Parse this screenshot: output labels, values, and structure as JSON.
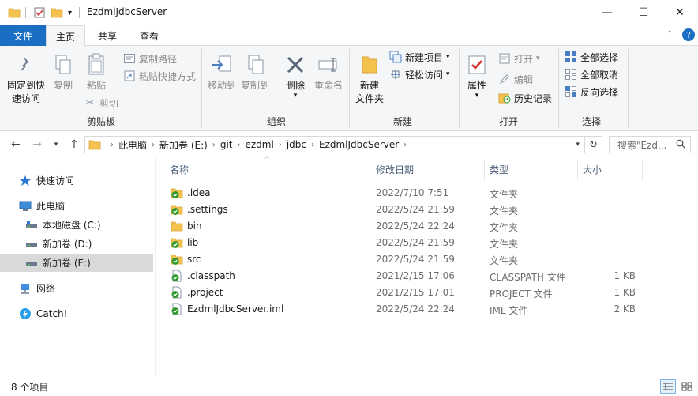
{
  "window": {
    "title": "EzdmlJdbcServer",
    "minimize": "—",
    "maximize": "☐",
    "close": "✕"
  },
  "ribbon_tabs": {
    "file": "文件",
    "home": "主页",
    "share": "共享",
    "view": "查看"
  },
  "ribbon": {
    "clipboard": {
      "group": "剪贴板",
      "pin_line1": "固定到快",
      "pin_line2": "速访问",
      "copy": "复制",
      "paste": "粘贴",
      "copy_path": "复制路径",
      "paste_shortcut": "粘贴快捷方式",
      "cut": "剪切"
    },
    "organize": {
      "group": "组织",
      "move_to": "移动到",
      "copy_to": "复制到",
      "delete": "删除",
      "rename": "重命名"
    },
    "new": {
      "group": "新建",
      "new_folder_line1": "新建",
      "new_folder_line2": "文件夹",
      "new_item": "新建项目",
      "easy_access": "轻松访问"
    },
    "open": {
      "group": "打开",
      "properties": "属性",
      "open": "打开",
      "edit": "编辑",
      "history": "历史记录"
    },
    "select": {
      "group": "选择",
      "select_all": "全部选择",
      "select_none": "全部取消",
      "invert": "反向选择"
    }
  },
  "address": {
    "crumbs": [
      "此电脑",
      "新加卷 (E:)",
      "git",
      "ezdml",
      "jdbc",
      "EzdmlJdbcServer"
    ],
    "search_placeholder": "搜索\"Ezd..."
  },
  "sidebar": {
    "items": [
      {
        "label": "快速访问",
        "icon": "star-icon"
      },
      {
        "label": "此电脑",
        "icon": "computer-icon"
      },
      {
        "label": "本地磁盘 (C:)",
        "icon": "drive-icon"
      },
      {
        "label": "新加卷 (D:)",
        "icon": "drive-icon"
      },
      {
        "label": "新加卷 (E:)",
        "icon": "drive-icon"
      },
      {
        "label": "网络",
        "icon": "network-icon"
      },
      {
        "label": "Catch!",
        "icon": "catch-icon"
      }
    ]
  },
  "columns": {
    "name": "名称",
    "date": "修改日期",
    "type": "类型",
    "size": "大小"
  },
  "files": [
    {
      "name": ".idea",
      "date": "2022/7/10 7:51",
      "type": "文件夹",
      "size": "",
      "kind": "folder-synced"
    },
    {
      "name": ".settings",
      "date": "2022/5/24 21:59",
      "type": "文件夹",
      "size": "",
      "kind": "folder-synced"
    },
    {
      "name": "bin",
      "date": "2022/5/24 22:24",
      "type": "文件夹",
      "size": "",
      "kind": "folder"
    },
    {
      "name": "lib",
      "date": "2022/5/24 21:59",
      "type": "文件夹",
      "size": "",
      "kind": "folder-synced"
    },
    {
      "name": "src",
      "date": "2022/5/24 21:59",
      "type": "文件夹",
      "size": "",
      "kind": "folder-synced"
    },
    {
      "name": ".classpath",
      "date": "2021/2/15 17:06",
      "type": "CLASSPATH 文件",
      "size": "1 KB",
      "kind": "file-synced"
    },
    {
      "name": ".project",
      "date": "2021/2/15 17:01",
      "type": "PROJECT 文件",
      "size": "1 KB",
      "kind": "file-synced"
    },
    {
      "name": "EzdmlJdbcServer.iml",
      "date": "2022/5/24 22:24",
      "type": "IML 文件",
      "size": "2 KB",
      "kind": "file-synced"
    }
  ],
  "status": {
    "item_count": "8 个项目"
  },
  "colors": {
    "accent": "#1a6fc4",
    "folder": "#f4c24d",
    "sync_green": "#2e9a2e",
    "selected_sidebar": "#d9d9d9"
  }
}
